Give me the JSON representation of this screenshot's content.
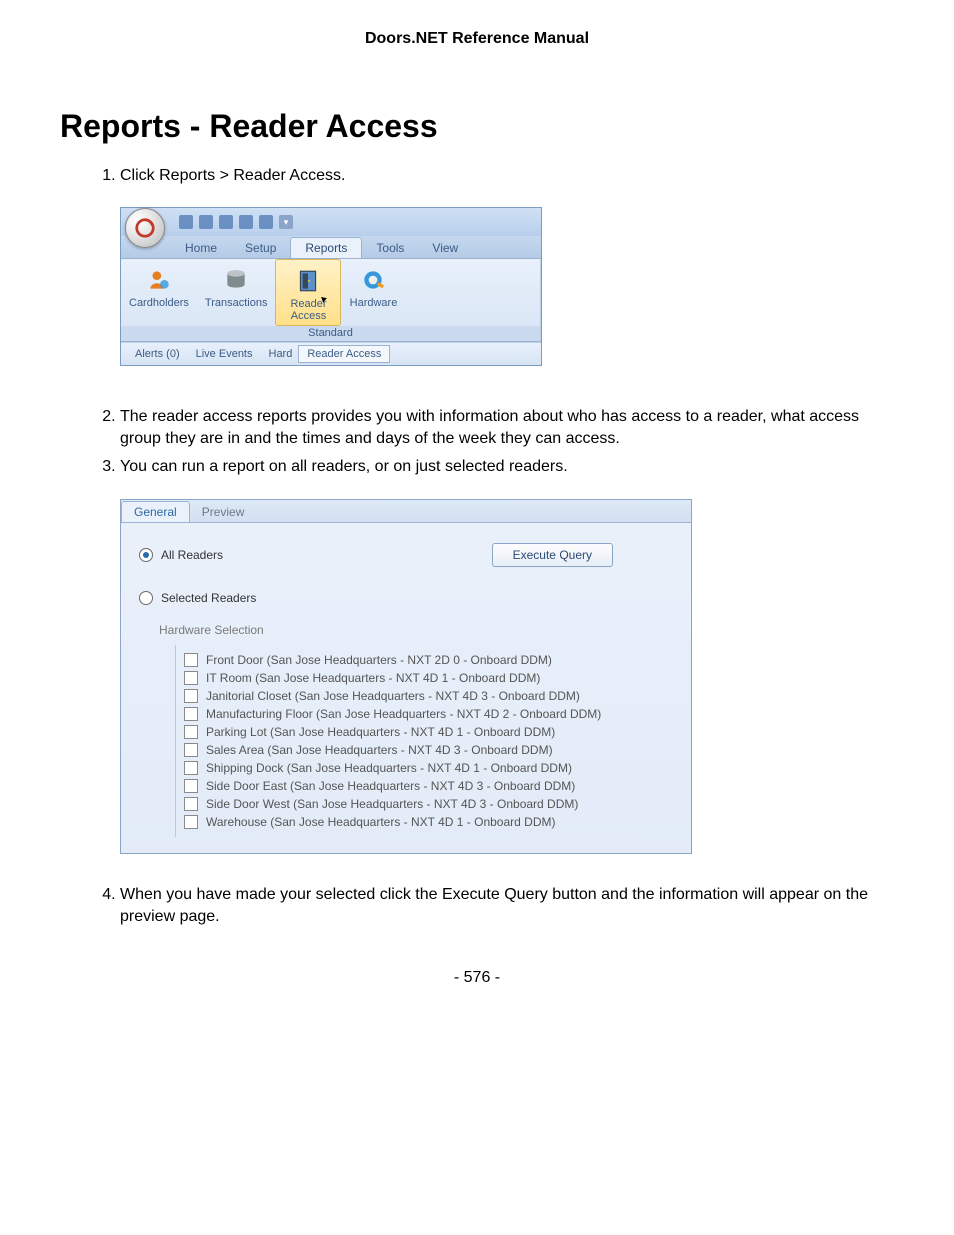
{
  "header": "Doors.NET Reference Manual",
  "title": "Reports - Reader Access",
  "steps": {
    "s1": "Click Reports > Reader Access.",
    "s2": "The reader access reports provides you with information about who has access to a reader, what access group they are in and the times and days of the week they can access.",
    "s3": "You can run a report on all readers, or on just selected readers.",
    "s4": "When you have made your selected click the Execute Query button and the information will appear on the preview page."
  },
  "footer": "- 576 -",
  "shot1": {
    "tabs": {
      "home": "Home",
      "setup": "Setup",
      "reports": "Reports",
      "tools": "Tools",
      "view": "View"
    },
    "ribbon": {
      "cardholders": "Cardholders",
      "transactions": "Transactions",
      "reader_access_l1": "Reader",
      "reader_access_l2": "Access",
      "hardware": "Hardware",
      "group_caption": "Standard"
    },
    "status": {
      "alerts": "Alerts (0)",
      "live_events": "Live Events",
      "hard": "Hard",
      "reader_access": "Reader Access"
    }
  },
  "shot2": {
    "tabs": {
      "general": "General",
      "preview": "Preview"
    },
    "radios": {
      "all": "All Readers",
      "selected": "Selected Readers"
    },
    "execute": "Execute Query",
    "section": "Hardware Selection",
    "items": [
      "Front Door (San Jose Headquarters - NXT 2D 0 - Onboard DDM)",
      "IT Room (San Jose Headquarters - NXT 4D 1 - Onboard DDM)",
      "Janitorial Closet (San Jose Headquarters - NXT 4D 3 - Onboard DDM)",
      "Manufacturing Floor (San Jose Headquarters - NXT 4D 2 - Onboard DDM)",
      "Parking Lot (San Jose Headquarters - NXT 4D 1 - Onboard DDM)",
      "Sales Area (San Jose Headquarters - NXT 4D 3 - Onboard DDM)",
      "Shipping Dock (San Jose Headquarters - NXT 4D 1 - Onboard DDM)",
      "Side Door East (San Jose Headquarters - NXT 4D 3 - Onboard DDM)",
      "Side Door West (San Jose Headquarters - NXT 4D 3 - Onboard DDM)",
      "Warehouse (San Jose Headquarters - NXT 4D 1 - Onboard DDM)"
    ]
  }
}
